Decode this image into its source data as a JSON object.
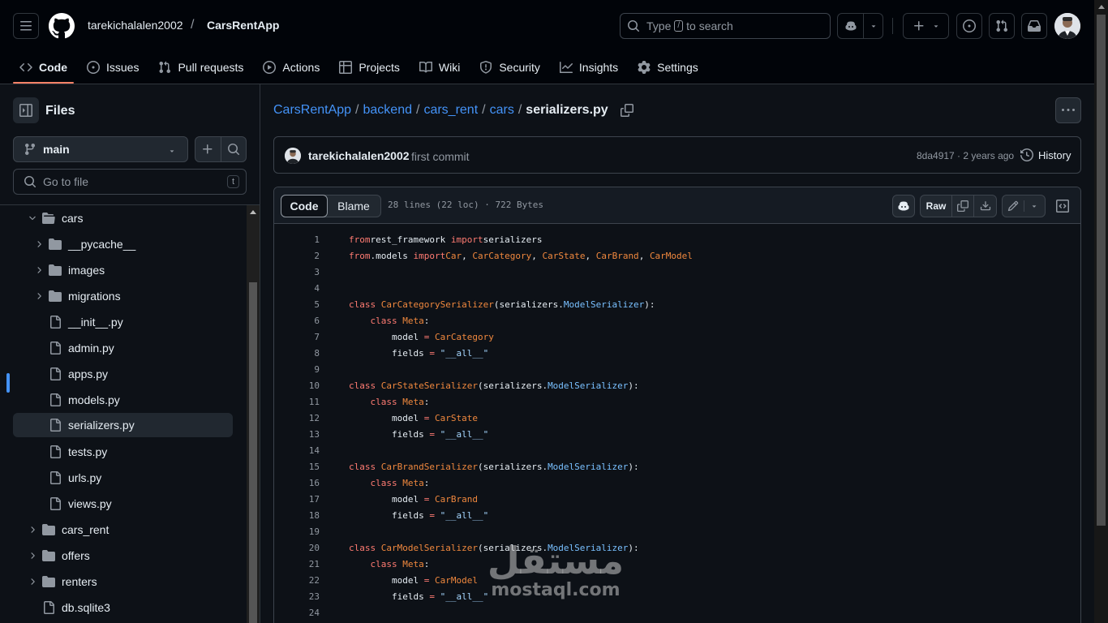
{
  "header": {
    "owner": "tarekichalalen2002",
    "slash": "/",
    "repo": "CarsRentApp",
    "search_prefix": "Type",
    "search_key": "/",
    "search_suffix": "to search"
  },
  "repo_nav": [
    {
      "label": "Code",
      "icon": "code-icon",
      "active": true
    },
    {
      "label": "Issues",
      "icon": "issue-icon"
    },
    {
      "label": "Pull requests",
      "icon": "pull-request-icon"
    },
    {
      "label": "Actions",
      "icon": "play-icon"
    },
    {
      "label": "Projects",
      "icon": "table-icon"
    },
    {
      "label": "Wiki",
      "icon": "book-icon"
    },
    {
      "label": "Security",
      "icon": "shield-icon"
    },
    {
      "label": "Insights",
      "icon": "graph-icon"
    },
    {
      "label": "Settings",
      "icon": "gear-icon"
    }
  ],
  "sidebar": {
    "title": "Files",
    "branch": "main",
    "goto_placeholder": "Go to file",
    "goto_key": "t",
    "tree": [
      {
        "label": "cars",
        "type": "folder",
        "level": 1,
        "expanded": true
      },
      {
        "label": "__pycache__",
        "type": "folder",
        "level": 2
      },
      {
        "label": "images",
        "type": "folder",
        "level": 2
      },
      {
        "label": "migrations",
        "type": "folder",
        "level": 2
      },
      {
        "label": "__init__.py",
        "type": "file",
        "level": 2
      },
      {
        "label": "admin.py",
        "type": "file",
        "level": 2
      },
      {
        "label": "apps.py",
        "type": "file",
        "level": 2
      },
      {
        "label": "models.py",
        "type": "file",
        "level": 2
      },
      {
        "label": "serializers.py",
        "type": "file",
        "level": 2,
        "selected": true
      },
      {
        "label": "tests.py",
        "type": "file",
        "level": 2
      },
      {
        "label": "urls.py",
        "type": "file",
        "level": 2
      },
      {
        "label": "views.py",
        "type": "file",
        "level": 2
      },
      {
        "label": "cars_rent",
        "type": "folder",
        "level": 1
      },
      {
        "label": "offers",
        "type": "folder",
        "level": 1
      },
      {
        "label": "renters",
        "type": "folder",
        "level": 1
      },
      {
        "label": "db.sqlite3",
        "type": "file",
        "level": 1
      }
    ]
  },
  "breadcrumb": {
    "parts": [
      "CarsRentApp",
      "backend",
      "cars_rent",
      "cars"
    ],
    "sep": "/",
    "current": "serializers.py"
  },
  "commit": {
    "author": "tarekichalalen2002",
    "message": "first commit",
    "sha_age": "8da4917 · 2 years ago",
    "history": "History"
  },
  "file": {
    "tab_code": "Code",
    "tab_blame": "Blame",
    "info": "28 lines (22 loc) · 722 Bytes",
    "raw": "Raw"
  },
  "code_lines": [
    [
      [
        "kw",
        "from"
      ],
      [
        "",
        "rest_framework "
      ],
      [
        "kw",
        "import"
      ],
      [
        "",
        "serializers"
      ]
    ],
    [
      [
        "kw",
        "from"
      ],
      [
        "",
        ".models "
      ],
      [
        "kw",
        "import"
      ],
      [
        "cl",
        "Car"
      ],
      [
        "",
        ", "
      ],
      [
        "cl",
        "CarCategory"
      ],
      [
        "",
        ", "
      ],
      [
        "cl",
        "CarState"
      ],
      [
        "",
        ", "
      ],
      [
        "cl",
        "CarBrand"
      ],
      [
        "",
        ", "
      ],
      [
        "cl",
        "CarModel"
      ]
    ],
    [],
    [],
    [
      [
        "kw",
        "class "
      ],
      [
        "cl",
        "CarCategorySerializer"
      ],
      [
        "",
        "(serializers."
      ],
      [
        "bi",
        "ModelSerializer"
      ],
      [
        "",
        "):"
      ]
    ],
    [
      [
        "",
        "    "
      ],
      [
        "kw",
        "class "
      ],
      [
        "cl",
        "Meta"
      ],
      [
        "",
        ":"
      ]
    ],
    [
      [
        "",
        "        model "
      ],
      [
        "kw",
        "="
      ],
      [
        "",
        ""
      ],
      [
        "cl",
        " CarCategory"
      ]
    ],
    [
      [
        "",
        "        fields "
      ],
      [
        "kw",
        "="
      ],
      [
        "st",
        " \"__all__\""
      ]
    ],
    [],
    [
      [
        "kw",
        "class "
      ],
      [
        "cl",
        "CarStateSerializer"
      ],
      [
        "",
        "(serializers."
      ],
      [
        "bi",
        "ModelSerializer"
      ],
      [
        "",
        "):"
      ]
    ],
    [
      [
        "",
        "    "
      ],
      [
        "kw",
        "class "
      ],
      [
        "cl",
        "Meta"
      ],
      [
        "",
        ":"
      ]
    ],
    [
      [
        "",
        "        model "
      ],
      [
        "kw",
        "="
      ],
      [
        "cl",
        " CarState"
      ]
    ],
    [
      [
        "",
        "        fields "
      ],
      [
        "kw",
        "="
      ],
      [
        "st",
        " \"__all__\""
      ]
    ],
    [],
    [
      [
        "kw",
        "class "
      ],
      [
        "cl",
        "CarBrandSerializer"
      ],
      [
        "",
        "(serializers."
      ],
      [
        "bi",
        "ModelSerializer"
      ],
      [
        "",
        "):"
      ]
    ],
    [
      [
        "",
        "    "
      ],
      [
        "kw",
        "class "
      ],
      [
        "cl",
        "Meta"
      ],
      [
        "",
        ":"
      ]
    ],
    [
      [
        "",
        "        model "
      ],
      [
        "kw",
        "="
      ],
      [
        "cl",
        " CarBrand"
      ]
    ],
    [
      [
        "",
        "        fields "
      ],
      [
        "kw",
        "="
      ],
      [
        "st",
        " \"__all__\""
      ]
    ],
    [],
    [
      [
        "kw",
        "class "
      ],
      [
        "cl",
        "CarModelSerializer"
      ],
      [
        "",
        "(serializers."
      ],
      [
        "bi",
        "ModelSerializer"
      ],
      [
        "",
        "):"
      ]
    ],
    [
      [
        "",
        "    "
      ],
      [
        "kw",
        "class "
      ],
      [
        "cl",
        "Meta"
      ],
      [
        "",
        ":"
      ]
    ],
    [
      [
        "",
        "        model "
      ],
      [
        "kw",
        "="
      ],
      [
        "cl",
        " CarModel"
      ]
    ],
    [
      [
        "",
        "        fields "
      ],
      [
        "kw",
        "="
      ],
      [
        "st",
        " \"__all__\""
      ]
    ],
    []
  ],
  "watermark": {
    "arabic": "مستقل",
    "latin": "mostaql.com"
  }
}
